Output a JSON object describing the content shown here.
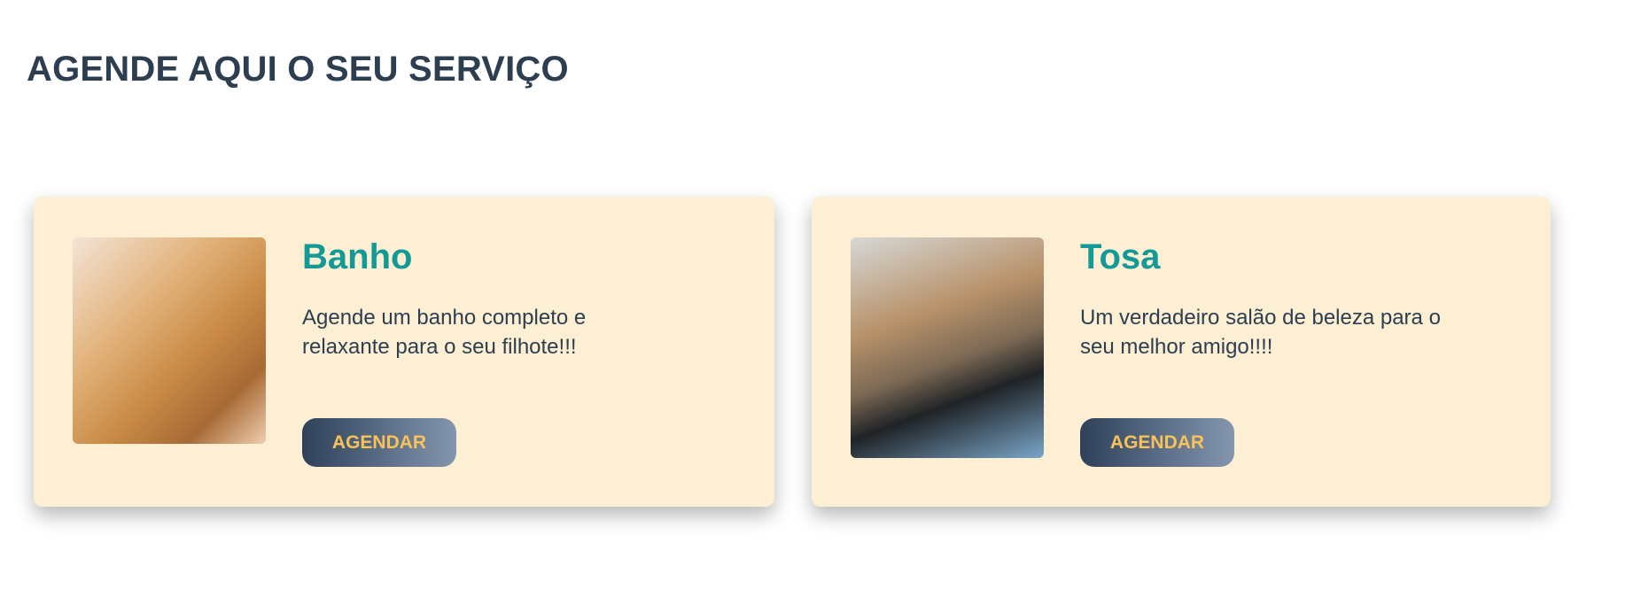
{
  "page": {
    "title": "AGENDE AQUI O SEU SERVIÇO"
  },
  "services": [
    {
      "title": "Banho",
      "description": "Agende um banho completo e relaxante para o seu filhote!!!",
      "button_label": "AGENDAR",
      "image": "dog-bath-photo"
    },
    {
      "title": "Tosa",
      "description": "Um verdadeiro salão de beleza para o seu melhor amigo!!!!",
      "button_label": "AGENDAR",
      "image": "dog-grooming-photo"
    }
  ],
  "colors": {
    "heading": "#2c3e50",
    "card_bg": "#fdefd3",
    "service_title": "#139a96",
    "button_text": "#f8c25a",
    "button_gradient": [
      "#2f4159",
      "#8496ad"
    ]
  }
}
